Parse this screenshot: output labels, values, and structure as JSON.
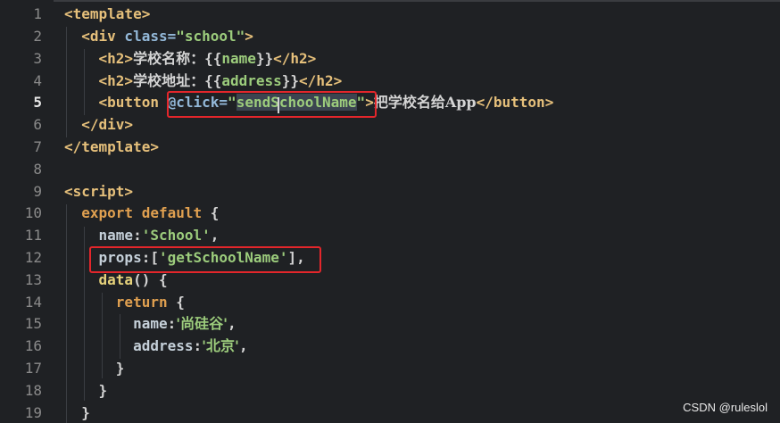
{
  "editor": {
    "active_line": 5,
    "lines": [
      {
        "n": "1",
        "tokens": [
          {
            "t": "<template>",
            "c": "tag"
          }
        ]
      },
      {
        "n": "2",
        "tokens": [
          {
            "t": "  ",
            "c": "text"
          },
          {
            "t": "<div",
            "c": "tag"
          },
          {
            "t": " class=",
            "c": "attr"
          },
          {
            "t": "\"school\"",
            "c": "str"
          },
          {
            "t": ">",
            "c": "tag"
          }
        ]
      },
      {
        "n": "3",
        "tokens": [
          {
            "t": "    ",
            "c": "text"
          },
          {
            "t": "<h2>",
            "c": "tag"
          },
          {
            "t": "学校名称：",
            "c": "text cn"
          },
          {
            "t": "{{",
            "c": "punc"
          },
          {
            "t": "name",
            "c": "str"
          },
          {
            "t": "}}",
            "c": "punc"
          },
          {
            "t": "</h2>",
            "c": "tag"
          }
        ]
      },
      {
        "n": "4",
        "tokens": [
          {
            "t": "    ",
            "c": "text"
          },
          {
            "t": "<h2>",
            "c": "tag"
          },
          {
            "t": "学校地址：",
            "c": "text cn"
          },
          {
            "t": "{{",
            "c": "punc"
          },
          {
            "t": "address",
            "c": "str"
          },
          {
            "t": "}}",
            "c": "punc"
          },
          {
            "t": "</h2>",
            "c": "tag"
          }
        ]
      },
      {
        "n": "5",
        "tokens": [
          {
            "t": "    ",
            "c": "text"
          },
          {
            "t": "<button",
            "c": "tag"
          },
          {
            "t": " ",
            "c": "text"
          },
          {
            "t": "@click=",
            "c": "attr"
          },
          {
            "t": "\"",
            "c": "str"
          },
          {
            "t": "sendSchoolName",
            "c": "str sel"
          },
          {
            "t": "\"",
            "c": "str"
          },
          {
            "t": ">",
            "c": "tag"
          },
          {
            "t": "把学校名给App",
            "c": "text cn"
          },
          {
            "t": "</button>",
            "c": "tag"
          }
        ]
      },
      {
        "n": "6",
        "tokens": [
          {
            "t": "  ",
            "c": "text"
          },
          {
            "t": "</div>",
            "c": "tag"
          }
        ]
      },
      {
        "n": "7",
        "tokens": [
          {
            "t": "</template>",
            "c": "tag"
          }
        ]
      },
      {
        "n": "8",
        "tokens": []
      },
      {
        "n": "9",
        "tokens": [
          {
            "t": "<script>",
            "c": "tag"
          }
        ]
      },
      {
        "n": "10",
        "tokens": [
          {
            "t": "  ",
            "c": "text"
          },
          {
            "t": "export default",
            "c": "kw"
          },
          {
            "t": " {",
            "c": "punc"
          }
        ]
      },
      {
        "n": "11",
        "tokens": [
          {
            "t": "    ",
            "c": "text"
          },
          {
            "t": "name",
            "c": "prop"
          },
          {
            "t": ":",
            "c": "punc"
          },
          {
            "t": "'School'",
            "c": "str"
          },
          {
            "t": ",",
            "c": "punc"
          }
        ]
      },
      {
        "n": "12",
        "tokens": [
          {
            "t": "    ",
            "c": "text"
          },
          {
            "t": "props",
            "c": "prop"
          },
          {
            "t": ":[",
            "c": "punc"
          },
          {
            "t": "'getSchoolName'",
            "c": "str"
          },
          {
            "t": "],",
            "c": "punc"
          }
        ]
      },
      {
        "n": "13",
        "tokens": [
          {
            "t": "    ",
            "c": "text"
          },
          {
            "t": "data",
            "c": "fn"
          },
          {
            "t": "() {",
            "c": "punc"
          }
        ]
      },
      {
        "n": "14",
        "tokens": [
          {
            "t": "      ",
            "c": "text"
          },
          {
            "t": "return",
            "c": "kw"
          },
          {
            "t": " {",
            "c": "punc"
          }
        ]
      },
      {
        "n": "15",
        "tokens": [
          {
            "t": "        ",
            "c": "text"
          },
          {
            "t": "name",
            "c": "prop"
          },
          {
            "t": ":",
            "c": "punc"
          },
          {
            "t": "'尚硅谷'",
            "c": "str cn"
          },
          {
            "t": ",",
            "c": "punc"
          }
        ]
      },
      {
        "n": "16",
        "tokens": [
          {
            "t": "        ",
            "c": "text"
          },
          {
            "t": "address",
            "c": "prop"
          },
          {
            "t": ":",
            "c": "punc"
          },
          {
            "t": "'北京'",
            "c": "str cn"
          },
          {
            "t": ",",
            "c": "punc"
          }
        ]
      },
      {
        "n": "17",
        "tokens": [
          {
            "t": "      ",
            "c": "text"
          },
          {
            "t": "}",
            "c": "punc"
          }
        ]
      },
      {
        "n": "18",
        "tokens": [
          {
            "t": "    ",
            "c": "text"
          },
          {
            "t": "}",
            "c": "punc"
          }
        ]
      },
      {
        "n": "19",
        "tokens": [
          {
            "t": "  ",
            "c": "text"
          },
          {
            "t": "}",
            "c": "punc"
          }
        ]
      }
    ]
  },
  "watermark": "CSDN @ruleslol"
}
